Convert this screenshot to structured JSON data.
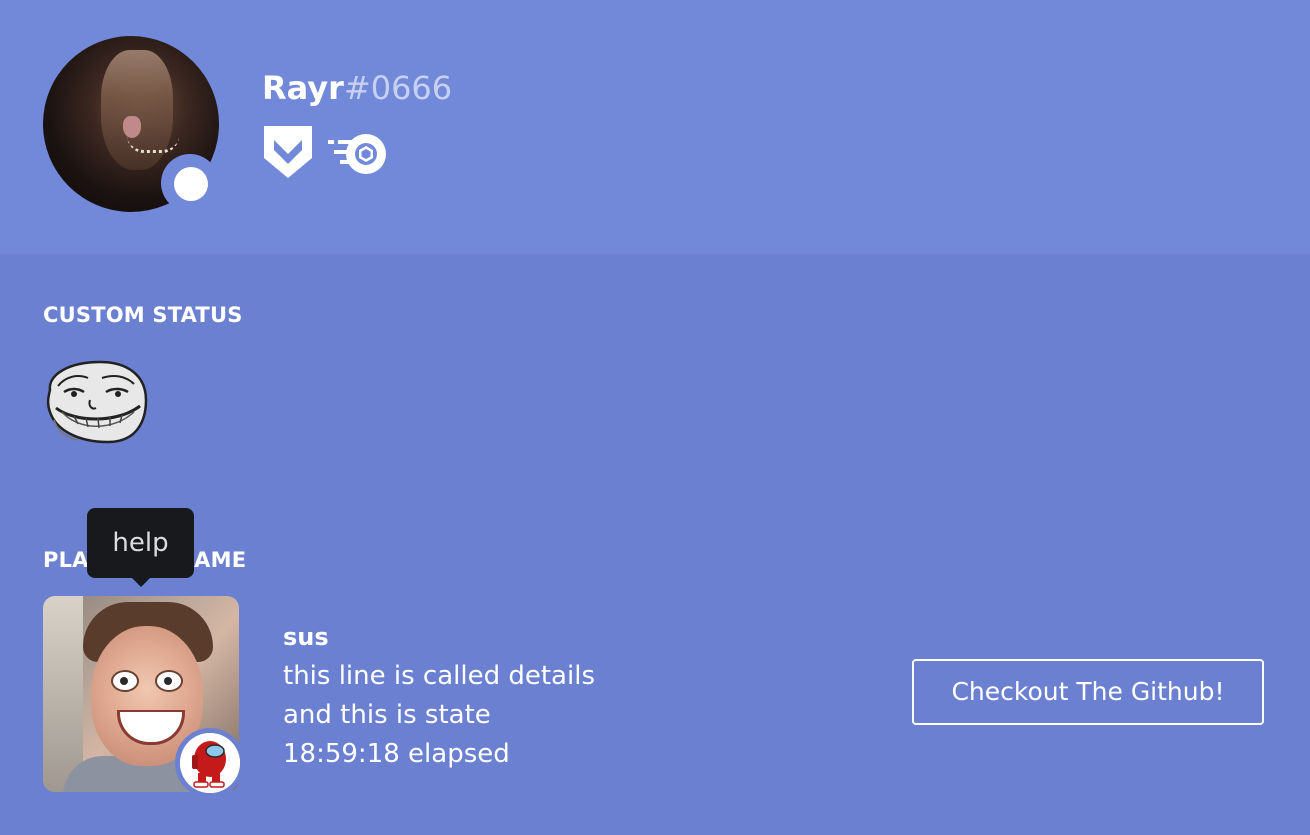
{
  "profile": {
    "username": "Rayr",
    "discriminator": "#0666",
    "status": "online",
    "badges": [
      "hypesquad-bravery-icon",
      "nitro-boost-icon"
    ]
  },
  "custom_status": {
    "title": "CUSTOM STATUS",
    "emoji": "trollface-emoji"
  },
  "activity": {
    "title": "PLAYING A GAME",
    "name": "sus",
    "details": "this line is called details",
    "state": "and this is state",
    "elapsed": "18:59:18 elapsed",
    "large_image": "laughing-man-image",
    "small_image": "red-among-us-character-image",
    "button_label": "Checkout The Github!"
  },
  "tooltip": {
    "text": "help"
  },
  "colors": {
    "header_bg": "#7289da",
    "body_bg": "#6b80d0",
    "tooltip_bg": "#18191c",
    "text": "#ffffff"
  }
}
